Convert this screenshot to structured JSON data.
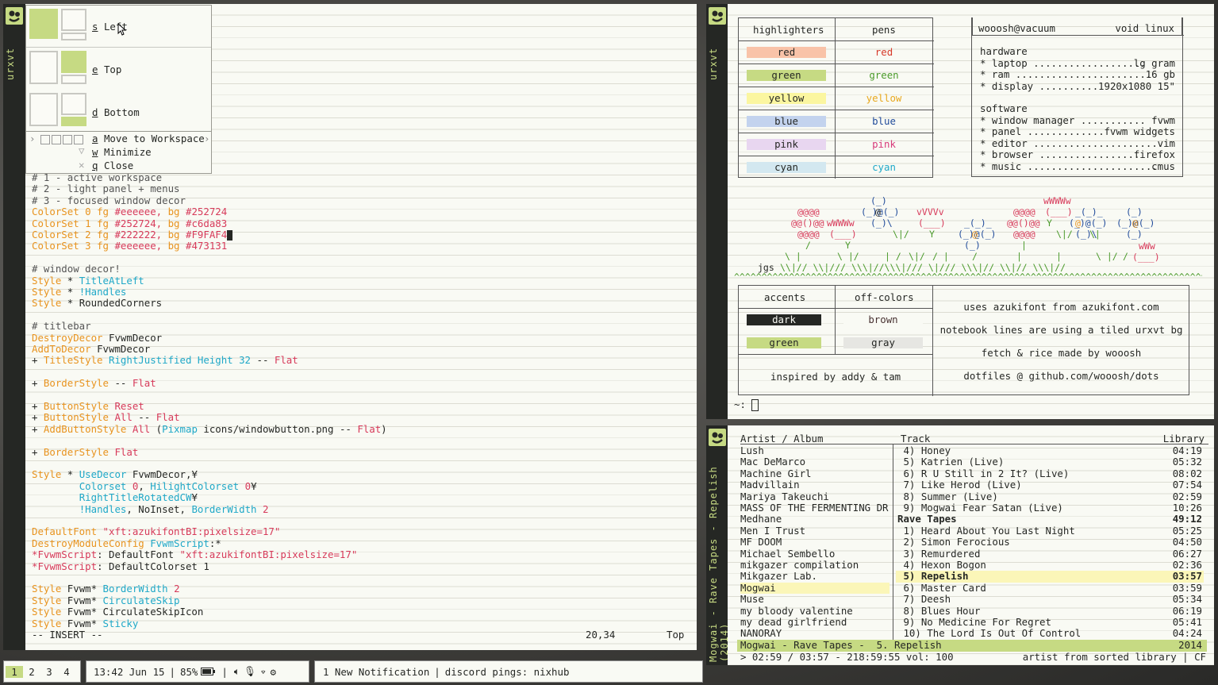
{
  "desktop": {
    "colors": {
      "bg": "#F9FAF4",
      "dark": "#252724",
      "accent_green": "#c6da83",
      "orange": "#e8931e",
      "red": "#d73a5a",
      "cyan": "#1fa8c8"
    }
  },
  "left_window": {
    "title": "urxvt",
    "menu": {
      "items": [
        {
          "key": "s",
          "label": "Left"
        },
        {
          "key": "e",
          "label": "Top"
        },
        {
          "key": "d",
          "label": "Bottom"
        },
        {
          "key": "a",
          "label": "Move to Workspace"
        },
        {
          "key": "w",
          "label": "Minimize"
        },
        {
          "key": "q",
          "label": "Close"
        }
      ]
    },
    "comments": [
      "# 1 - active workspace",
      "# 2 - light panel + menus",
      "# 3 - focused window decor"
    ],
    "colorsets": [
      {
        "kw": "ColorSet",
        "n": "0",
        "fg": "#eeeeee,",
        "bg": "#252724"
      },
      {
        "kw": "ColorSet",
        "n": "1",
        "fg": "#252724,",
        "bg": "#c6da83"
      },
      {
        "kw": "ColorSet",
        "n": "2",
        "fg": "#222222,",
        "bg": "#F9FAF4"
      },
      {
        "kw": "ColorSet",
        "n": "3",
        "fg": "#eeeeee,",
        "bg": "#473131"
      }
    ],
    "decor_comment": "# window decor!",
    "decor_styles": [
      "TitleAtLeft",
      "!Handles",
      "RoundedCorners"
    ],
    "titlebar_comment": "# titlebar",
    "status_mode": "-- INSERT --",
    "status_pos": "20,34",
    "status_where": "Top"
  },
  "panel": {
    "workspaces": [
      "1",
      "2",
      "3",
      "4"
    ],
    "clock": "13:42 Jun 15",
    "battery": "85%",
    "notification": "1 New Notification",
    "discord": "discord pings: nixhub"
  },
  "fetch_window": {
    "title": "urxvt",
    "col_highlighters": "highlighters",
    "col_pens": "pens",
    "colors": [
      {
        "name": "red",
        "hl": "#f9c3a8",
        "pen": "#d73a2a"
      },
      {
        "name": "green",
        "hl": "#c6da83",
        "pen": "#4a9a2a"
      },
      {
        "name": "yellow",
        "hl": "#fbf6a0",
        "pen": "#e8a81e"
      },
      {
        "name": "blue",
        "hl": "#c3d3ee",
        "pen": "#1f4a9a"
      },
      {
        "name": "pink",
        "hl": "#e8d6f0",
        "pen": "#d73a7a"
      },
      {
        "name": "cyan",
        "hl": "#d3e8f0",
        "pen": "#1fa8c8"
      }
    ],
    "user": "wooosh@vacuum",
    "distro": "void linux",
    "hardware_title": "hardware",
    "hardware": [
      {
        "k": "* laptop",
        "dots": " ...................",
        "v": " lg gram"
      },
      {
        "k": "* ram",
        "dots": " .......................",
        "v": " 16 gb"
      },
      {
        "k": "* display",
        "dots": " ..........",
        "v": " 1920x1080 15\""
      }
    ],
    "software_title": "software",
    "software": [
      {
        "k": "* window manager",
        "dots": " ...........",
        "v": " fvwm"
      },
      {
        "k": "* panel",
        "dots": " .............",
        "v": " fvwm widgets"
      },
      {
        "k": "* editor",
        "dots": " ......................",
        "v": " vim"
      },
      {
        "k": "* browser",
        "dots": " .................",
        "v": " firefox"
      },
      {
        "k": "* music",
        "dots": " ......................",
        "v": " cmus"
      }
    ],
    "signature": "jgs",
    "accents_header": "accents",
    "offcolors_header": "off-colors",
    "accents": [
      {
        "name": "dark",
        "bg": "#252724",
        "fg": "#F9FAF4"
      },
      {
        "name": "green",
        "bg": "#c6da83",
        "fg": "#252724"
      }
    ],
    "offcolors": [
      {
        "name": "brown",
        "bg": "#F9FAF4",
        "fg": "#473131"
      },
      {
        "name": "gray",
        "bg": "#e6e6e2",
        "fg": "#252724"
      }
    ],
    "inspired": "inspired by addy & tam",
    "notes": [
      "uses azukifont from azukifont.com",
      "notebook lines are using a tiled urxvt bg",
      "fetch & rice made by wooosh",
      "dotfiles @ github.com/wooosh/dots"
    ],
    "prompt": "~:"
  },
  "cmus_window": {
    "title": "Mogwai - Rave Tapes - Repelish (2014)",
    "header_artist": "Artist / Album",
    "header_track": "Track",
    "header_library": "Library",
    "artists": [
      "Lush",
      "Mac DeMarco",
      "Machine Girl",
      "Madvillain",
      "Mariya Takeuchi",
      "MASS OF THE FERMENTING DR",
      "Medhane",
      "Men I Trust",
      "MF DOOM",
      "Michael Sembello",
      "mikgazer compilation",
      "Mikgazer Lab.",
      "Mogwai",
      "Muse",
      "my bloody valentine",
      "my dead girlfriend",
      "NANORAY"
    ],
    "selected_artist": "Mogwai",
    "tracks": [
      {
        "t": "4) Honey",
        "d": "04:19",
        "kind": "track"
      },
      {
        "t": "5) Katrien (Live)",
        "d": "05:32",
        "kind": "track"
      },
      {
        "t": "6) R U Still in 2 It? (Live)",
        "d": "08:02",
        "kind": "track"
      },
      {
        "t": "7) Like Herod (Live)",
        "d": "07:54",
        "kind": "track"
      },
      {
        "t": "8) Summer (Live)",
        "d": "02:59",
        "kind": "track"
      },
      {
        "t": "9) Mogwai Fear Satan (Live)",
        "d": "10:26",
        "kind": "track"
      },
      {
        "t": "Rave Tapes",
        "d": "49:12",
        "kind": "album"
      },
      {
        "t": "1) Heard About You Last Night",
        "d": "05:25",
        "kind": "track"
      },
      {
        "t": "2) Simon Ferocious",
        "d": "04:50",
        "kind": "track"
      },
      {
        "t": "3) Remurdered",
        "d": "06:27",
        "kind": "track"
      },
      {
        "t": "4) Hexon Bogon",
        "d": "02:36",
        "kind": "track"
      },
      {
        "t": "5) Repelish",
        "d": "03:57",
        "kind": "playing"
      },
      {
        "t": "6) Master Card",
        "d": "03:59",
        "kind": "track"
      },
      {
        "t": "7) Deesh",
        "d": "05:34",
        "kind": "track"
      },
      {
        "t": "8) Blues Hour",
        "d": "06:19",
        "kind": "track"
      },
      {
        "t": "9) No Medicine For Regret",
        "d": "05:41",
        "kind": "track"
      },
      {
        "t": "10) The Lord Is Out Of Control",
        "d": "04:24",
        "kind": "track"
      }
    ],
    "now_playing": "Mogwai - Rave Tapes -  5. Repelish",
    "now_year": "2014",
    "status_left": "> 02:59 / 03:57 - 218:59:55 vol: 100",
    "status_right": "artist from sorted library | CF"
  }
}
